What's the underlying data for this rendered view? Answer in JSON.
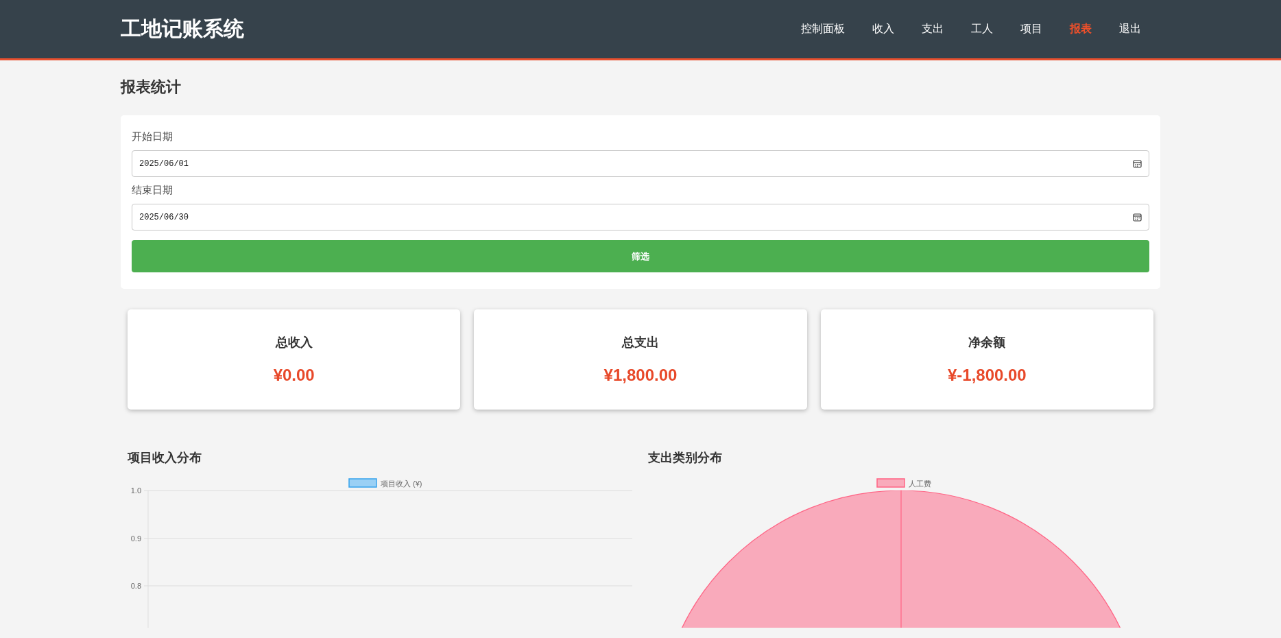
{
  "header": {
    "logo": "工地记账系统",
    "nav": [
      {
        "label": "控制面板",
        "selected": false
      },
      {
        "label": "收入",
        "selected": false
      },
      {
        "label": "支出",
        "selected": false
      },
      {
        "label": "工人",
        "selected": false
      },
      {
        "label": "项目",
        "selected": false
      },
      {
        "label": "报表",
        "selected": true
      },
      {
        "label": "退出",
        "selected": false
      }
    ]
  },
  "page_title": "报表统计",
  "filter": {
    "fields": [
      {
        "label": "开始日期",
        "value": "2025/06/01"
      },
      {
        "label": "结束日期",
        "value": "2025/06/30"
      }
    ],
    "button": "筛选"
  },
  "summary": [
    {
      "title": "总收入",
      "value": "¥0.00"
    },
    {
      "title": "总支出",
      "value": "¥1,800.00"
    },
    {
      "title": "净余额",
      "value": "¥-1,800.00"
    }
  ],
  "charts": [
    {
      "title": "项目收入分布",
      "chart_data": {
        "type": "bar",
        "series": [
          {
            "name": "项目收入 (¥)",
            "color": "#9ad0f5"
          }
        ],
        "ylim": [
          0,
          1
        ],
        "yticks": [
          {
            "value": 1,
            "label": "1.0"
          },
          {
            "value": 0.9,
            "label": "0.9"
          },
          {
            "value": 0.8,
            "label": "0.8"
          }
        ]
      }
    },
    {
      "title": "支出类别分布",
      "chart_data": {
        "type": "pie",
        "categories": [
          "人工费"
        ],
        "values": [
          100
        ]
      }
    }
  ]
}
